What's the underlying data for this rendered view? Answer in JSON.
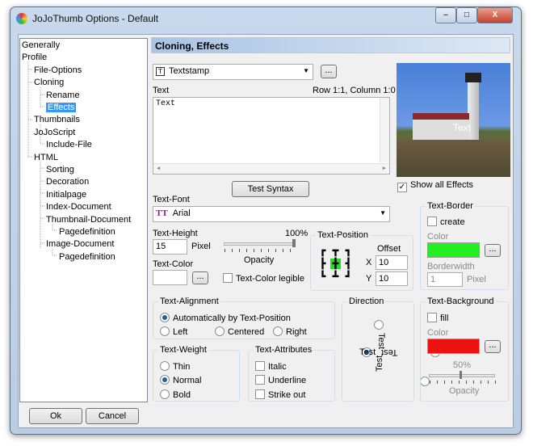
{
  "window": {
    "title": "JoJoThumb Options - Default",
    "minimize": "–",
    "maximize": "□",
    "close": "X"
  },
  "tree": [
    {
      "label": "Generally"
    },
    {
      "label": "Profile"
    },
    {
      "label": "File-Options"
    },
    {
      "label": "Cloning"
    },
    {
      "label": "Rename"
    },
    {
      "label": "Effects",
      "selected": true
    },
    {
      "label": "Thumbnails"
    },
    {
      "label": "JoJoScript"
    },
    {
      "label": "Include-File"
    },
    {
      "label": "HTML"
    },
    {
      "label": "Sorting"
    },
    {
      "label": "Decoration"
    },
    {
      "label": "Initialpage"
    },
    {
      "label": "Index-Document"
    },
    {
      "label": "Thumbnail-Document"
    },
    {
      "label": "Pagedefinition"
    },
    {
      "label": "Image-Document"
    },
    {
      "label": "Pagedefinition"
    }
  ],
  "header": "Cloning, Effects",
  "effect": {
    "selected": "Textstamp",
    "more": "..."
  },
  "text": {
    "label": "Text",
    "position": "Row 1:1, Column 1:0",
    "value": "Text",
    "test_syntax": "Test Syntax"
  },
  "preview": {
    "stamp": "Text",
    "show_all": "Show all Effects"
  },
  "font": {
    "label": "Text-Font",
    "value": "Arial",
    "icon": "TT"
  },
  "height": {
    "label": "Text-Height",
    "value": "15",
    "unit": "Pixel",
    "opacity_label": "Opacity",
    "opacity_value": "100%",
    "opacity": 100
  },
  "color": {
    "label": "Text-Color",
    "more": "...",
    "legible": "Text-Color legible",
    "value": "#ffffff"
  },
  "position": {
    "label": "Text-Position",
    "offset": "Offset",
    "x_label": "X",
    "x": "10",
    "y_label": "Y",
    "y": "10",
    "selected": "center"
  },
  "border": {
    "label": "Text-Border",
    "create": "create",
    "color_label": "Color",
    "color": "#22ee22",
    "more": "...",
    "width_label": "Borderwidth",
    "width": "1",
    "unit": "Pixel"
  },
  "alignment": {
    "label": "Text-Alignment",
    "auto": "Automatically by Text-Position",
    "left": "Left",
    "centered": "Centered",
    "right": "Right"
  },
  "direction": {
    "label": "Direction",
    "sample": "Test"
  },
  "background": {
    "label": "Text-Background",
    "fill": "fill",
    "color_label": "Color",
    "color": "#ee1111",
    "more": "...",
    "opacity_value": "50%",
    "opacity": 50,
    "opacity_label": "Opacity"
  },
  "weight": {
    "label": "Text-Weight",
    "thin": "Thin",
    "normal": "Normal",
    "bold": "Bold"
  },
  "attributes": {
    "label": "Text-Attributes",
    "italic": "Italic",
    "underline": "Underline",
    "strike": "Strike out"
  },
  "footer": {
    "ok": "Ok",
    "cancel": "Cancel"
  }
}
